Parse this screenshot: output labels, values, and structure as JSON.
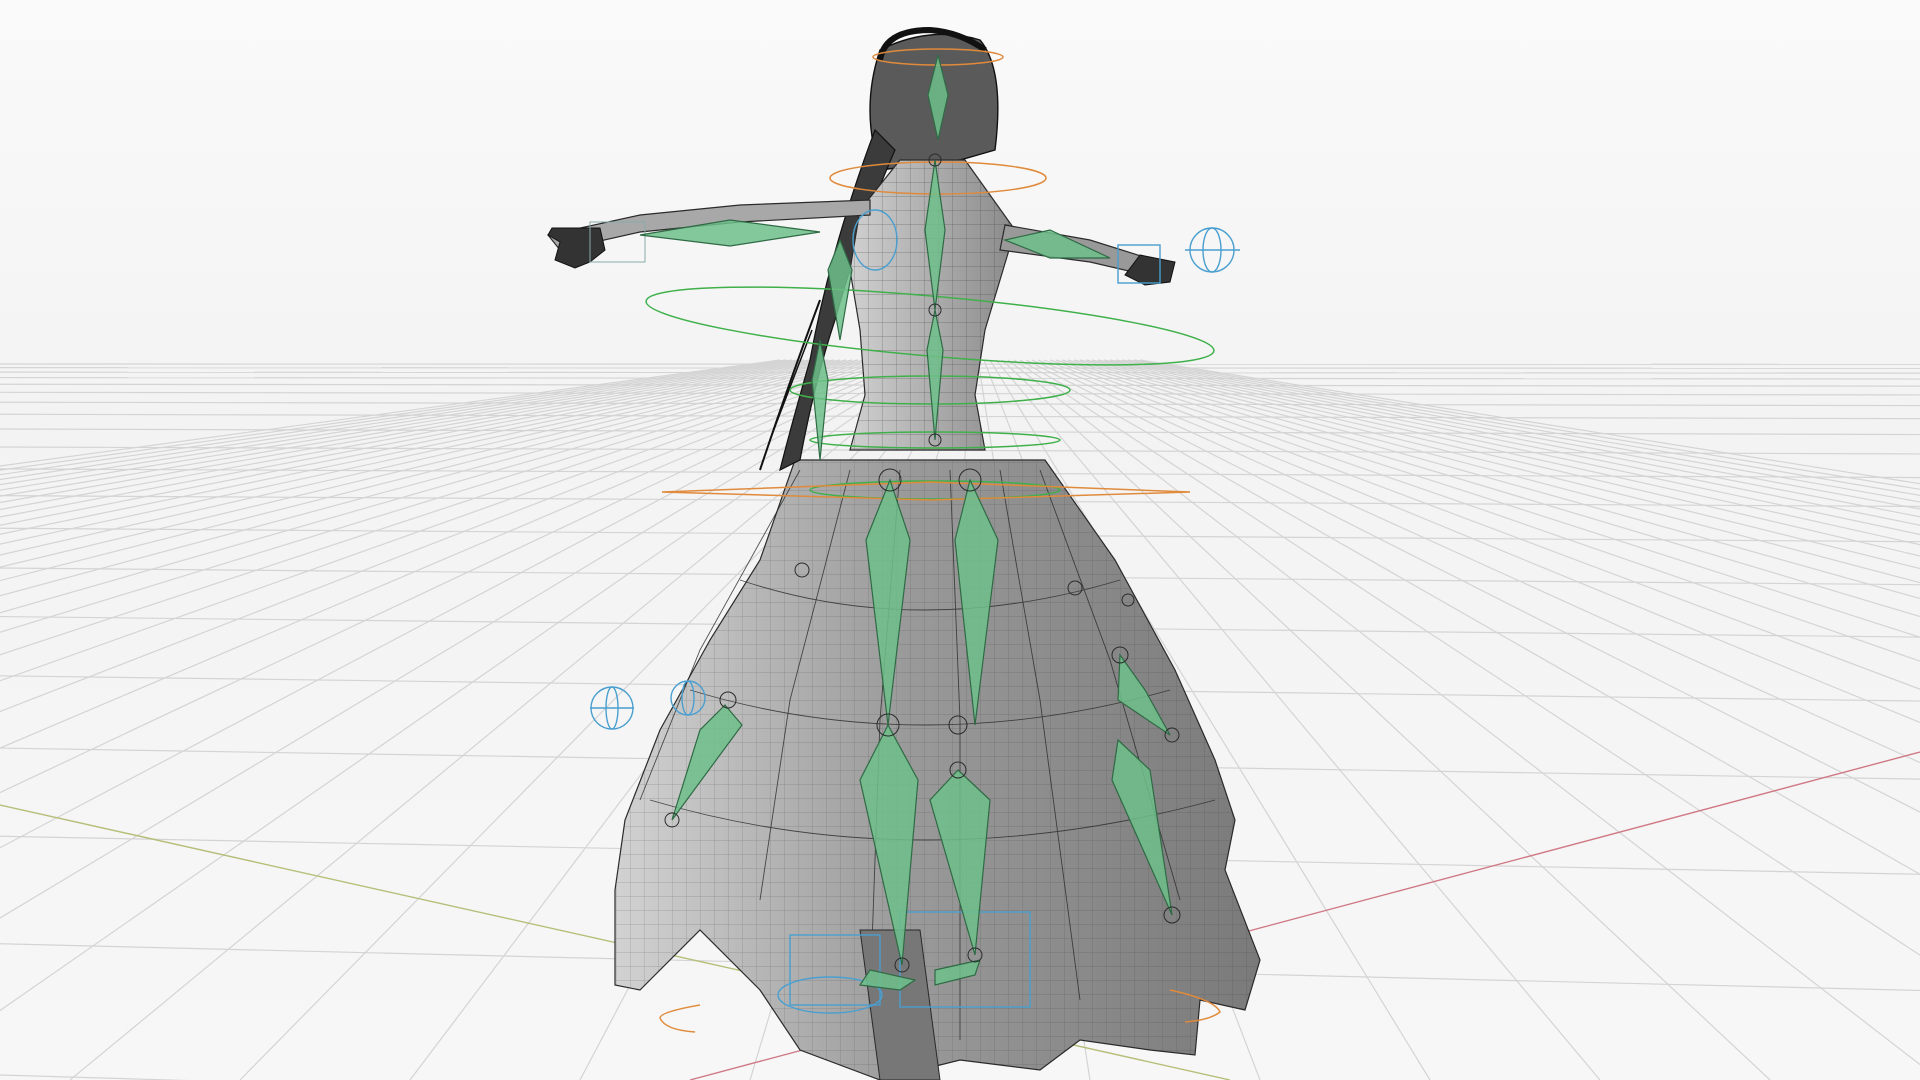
{
  "viewport": {
    "background": "#f6f6f6",
    "colors": {
      "grid": "#d4d4d4",
      "x_axis": "#d07a86",
      "y_axis": "#b7be78",
      "mesh_fill": "#8e8e8e",
      "mesh_wire": "#2a2a2a",
      "bone_fill": "#6fbf8a",
      "bone_stroke": "#2f6a45",
      "hip_controls": "#e08a3c",
      "torso_controls": "#3fb04a",
      "ik_controls": "#4a9fd0",
      "hair": "#1a1a1a"
    },
    "icons": [
      "orbit-gizmo-icon",
      "ik-widget-icon"
    ]
  }
}
